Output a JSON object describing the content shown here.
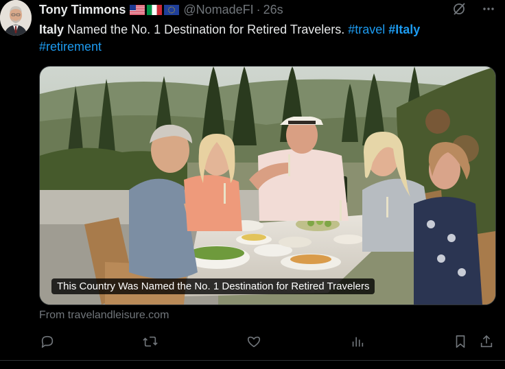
{
  "tweet": {
    "author_name": "Tony Timmons",
    "handle": "@NomadeFI",
    "separator": "·",
    "time": "26s",
    "flags": [
      "us-flag",
      "italy-flag",
      "eu-flag"
    ],
    "text_bold": "Italy",
    "text_main": " Named the No. 1 Destination for Retired Travelers. ",
    "hashtag_travel": "#travel",
    "hashtag_italy": "#Italy",
    "hashtag_retirement": "#retirement"
  },
  "card": {
    "title": "This Country Was Named the No. 1 Destination for Retired Travelers",
    "source": "From travelandleisure.com"
  },
  "actions": [
    "reply-icon",
    "retweet-icon",
    "like-icon",
    "views-icon",
    "bookmark-icon",
    "share-icon"
  ],
  "colors": {
    "background": "#000000",
    "text": "#e7e9ea",
    "muted": "#71767b",
    "link": "#1d9bf0"
  }
}
